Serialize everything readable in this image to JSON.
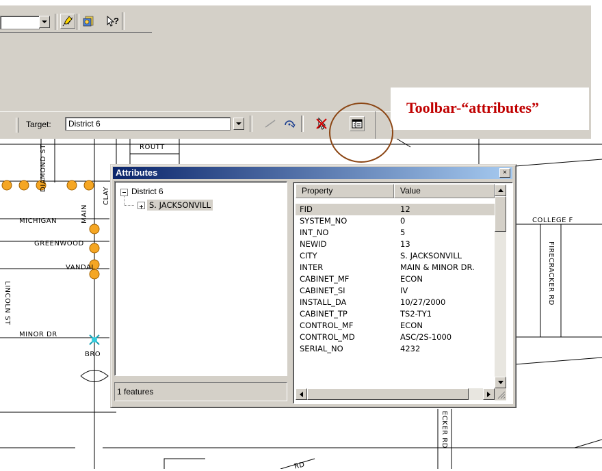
{
  "target_toolbar": {
    "target_label": "Target:",
    "target_value": "District 6"
  },
  "annotation": {
    "text": "Toolbar-“attributes”"
  },
  "map": {
    "streets": [
      "ROUTT",
      "DIAMOND ST",
      "CLAY",
      "MAIN",
      "MICHIGAN",
      "GREENWOOD",
      "VANDAL",
      "LINCOLN ST",
      "MINOR DR",
      "BRO",
      "COLLEGE F",
      "FIRECRACKER RD",
      "ECKER RD",
      "RD"
    ]
  },
  "dialog": {
    "title": "Attributes",
    "close_label": "×",
    "tree": {
      "root": "District 6",
      "child": "S. JACKSONVILL"
    },
    "status": "1 features",
    "columns": {
      "property": "Property",
      "value": "Value"
    },
    "rows": [
      {
        "property": "FID",
        "value": "12"
      },
      {
        "property": "SYSTEM_NO",
        "value": "0"
      },
      {
        "property": "INT_NO",
        "value": "5"
      },
      {
        "property": "NEWID",
        "value": "13"
      },
      {
        "property": "CITY",
        "value": "S. JACKSONVILL"
      },
      {
        "property": "INTER",
        "value": "MAIN & MINOR DR."
      },
      {
        "property": "CABINET_MF",
        "value": "ECON"
      },
      {
        "property": "CABINET_SI",
        "value": "IV"
      },
      {
        "property": "INSTALL_DA",
        "value": "10/27/2000"
      },
      {
        "property": "CABINET_TP",
        "value": "TS2-TY1"
      },
      {
        "property": "CONTROL_MF",
        "value": "ECON"
      },
      {
        "property": "CONTROL_MD",
        "value": "ASC/2S-1000"
      },
      {
        "property": "SERIAL_NO",
        "value": "4232"
      }
    ]
  },
  "icons": {
    "edit": "edit-sketch-icon",
    "identify": "identify-icon",
    "help": "whats-this-help-icon",
    "attributes": "attributes-table-icon"
  },
  "colors": {
    "annotation_text": "#c00000",
    "highlight_ellipse": "#8b4513",
    "intersection_node": "#f5a623",
    "selected_node": "#33ccdd",
    "title_bar": "#0a246a"
  }
}
